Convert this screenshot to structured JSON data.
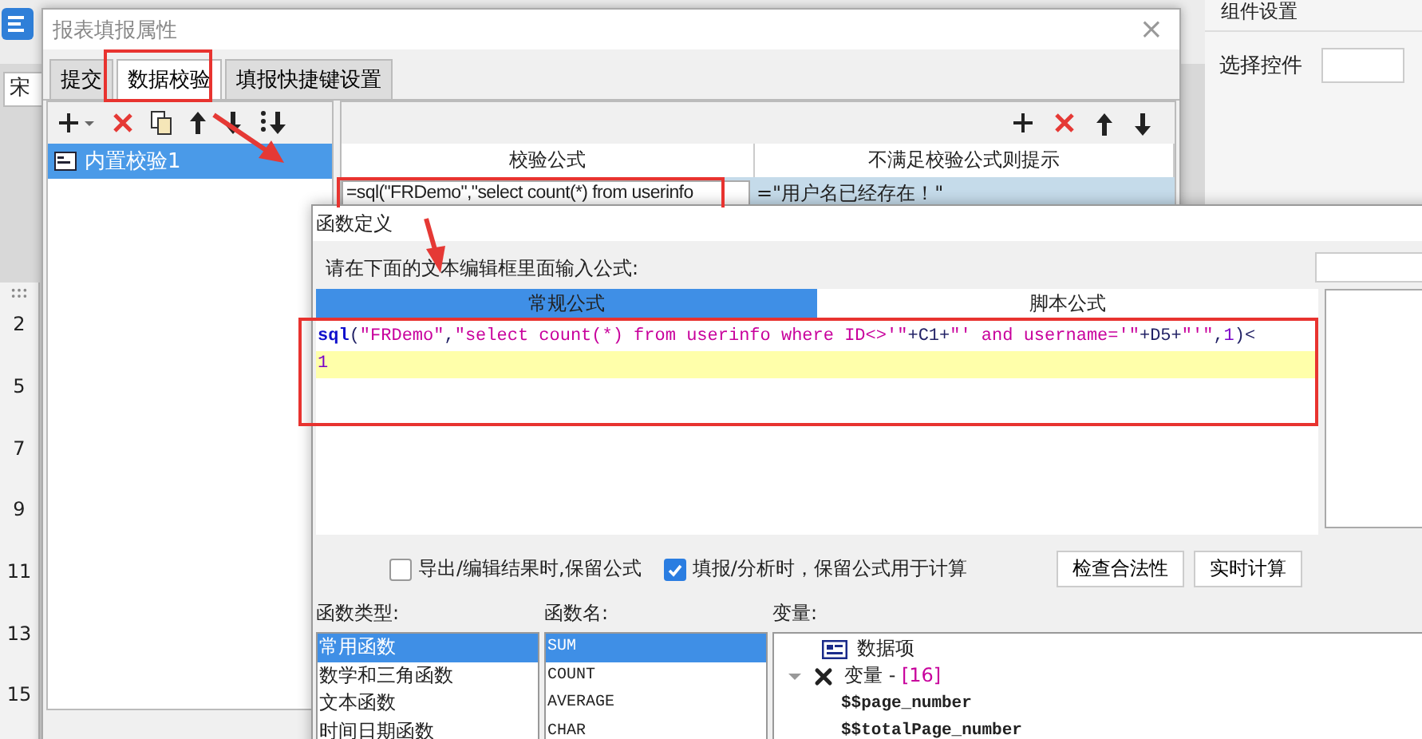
{
  "app": {
    "font_field": "宋",
    "row_numbers": [
      "2",
      "5",
      "7",
      "9",
      "11",
      "13",
      "15"
    ],
    "side_panel": {
      "title": "组件设置",
      "field_label": "选择控件"
    }
  },
  "dialog": {
    "title": "报表填报属性",
    "close": "×",
    "tabs": [
      {
        "label": "提交",
        "selected": false
      },
      {
        "label": "数据校验",
        "selected": true
      },
      {
        "label": "填报快捷键设置",
        "selected": false
      }
    ],
    "checks": [
      {
        "label": "内置校验1",
        "selected": true
      }
    ],
    "table": {
      "columns": [
        "校验公式",
        "不满足校验公式则提示"
      ],
      "rows": [
        {
          "cells": [
            "=sql(\"FRDemo\",\"select count(*) from userinfo",
            "=\"用户名已经存在！\""
          ],
          "selected": true
        }
      ]
    }
  },
  "formula_dialog": {
    "title": "函数定义",
    "prompt": "请在下面的文本编辑框里面输入公式:",
    "tabs": [
      {
        "label": "常规公式",
        "selected": true
      },
      {
        "label": "脚本公式",
        "selected": false
      }
    ],
    "lines": [
      {
        "current": false,
        "tokens": [
          {
            "kind": "func",
            "text": "sql"
          },
          {
            "kind": "op",
            "text": "("
          },
          {
            "kind": "string",
            "text": "\"FRDemo\""
          },
          {
            "kind": "op",
            "text": ","
          },
          {
            "kind": "string",
            "text": "\"select count(*) from userinfo where ID<>'\""
          },
          {
            "kind": "op",
            "text": "+"
          },
          {
            "kind": "ref",
            "text": "C1"
          },
          {
            "kind": "op",
            "text": "+"
          },
          {
            "kind": "string",
            "text": "\"' and username='\""
          },
          {
            "kind": "op",
            "text": "+"
          },
          {
            "kind": "ref",
            "text": "D5"
          },
          {
            "kind": "op",
            "text": "+"
          },
          {
            "kind": "string",
            "text": "\"'\""
          },
          {
            "kind": "op",
            "text": ","
          },
          {
            "kind": "number",
            "text": "1"
          },
          {
            "kind": "op",
            "text": ")<"
          }
        ]
      },
      {
        "current": true,
        "tokens": [
          {
            "kind": "number",
            "text": "1"
          }
        ]
      }
    ],
    "options": [
      {
        "label": "导出/编辑结果时,保留公式",
        "checked": false
      },
      {
        "label": "填报/分析时，保留公式用于计算",
        "checked": true
      }
    ],
    "buttons": [
      "检查合法性",
      "实时计算"
    ],
    "function_types": {
      "label": "函数类型:",
      "items": [
        {
          "label": "常用函数",
          "selected": true
        },
        {
          "label": "数学和三角函数",
          "selected": false
        },
        {
          "label": "文本函数",
          "selected": false
        },
        {
          "label": "时间日期函数",
          "selected": false
        }
      ]
    },
    "function_names": {
      "label": "函数名:",
      "items": [
        {
          "label": "SUM",
          "selected": true
        },
        {
          "label": "COUNT",
          "selected": false
        },
        {
          "label": "AVERAGE",
          "selected": false
        },
        {
          "label": "CHAR",
          "selected": false
        }
      ]
    },
    "variables": {
      "label": "变量:",
      "items": [
        {
          "kind": "data",
          "label": "数据项"
        },
        {
          "kind": "group",
          "label": "变量 - ",
          "count": "[16]",
          "expanded": true,
          "children": [
            {
              "label": "$$page_number"
            },
            {
              "label": "$$totalPage_number"
            }
          ]
        }
      ]
    }
  }
}
